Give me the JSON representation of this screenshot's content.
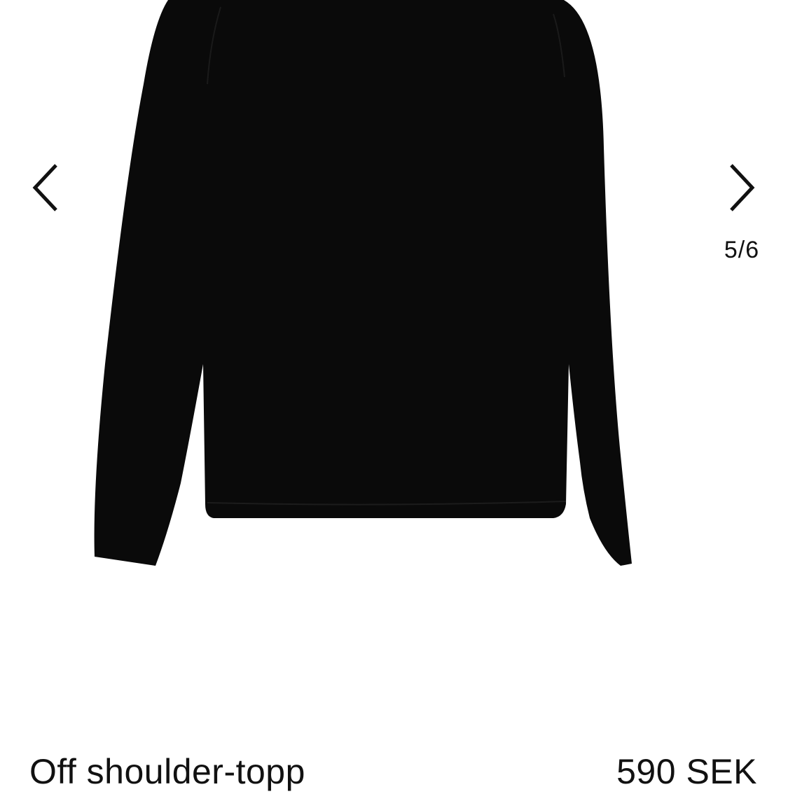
{
  "gallery": {
    "counter": "5/6",
    "prev_icon": "chevron-left-icon",
    "next_icon": "chevron-right-icon",
    "product_color": "#0a0a0a",
    "background_color": "#ffffff"
  },
  "product": {
    "name": "Off shoulder-topp",
    "price": "590 SEK"
  }
}
